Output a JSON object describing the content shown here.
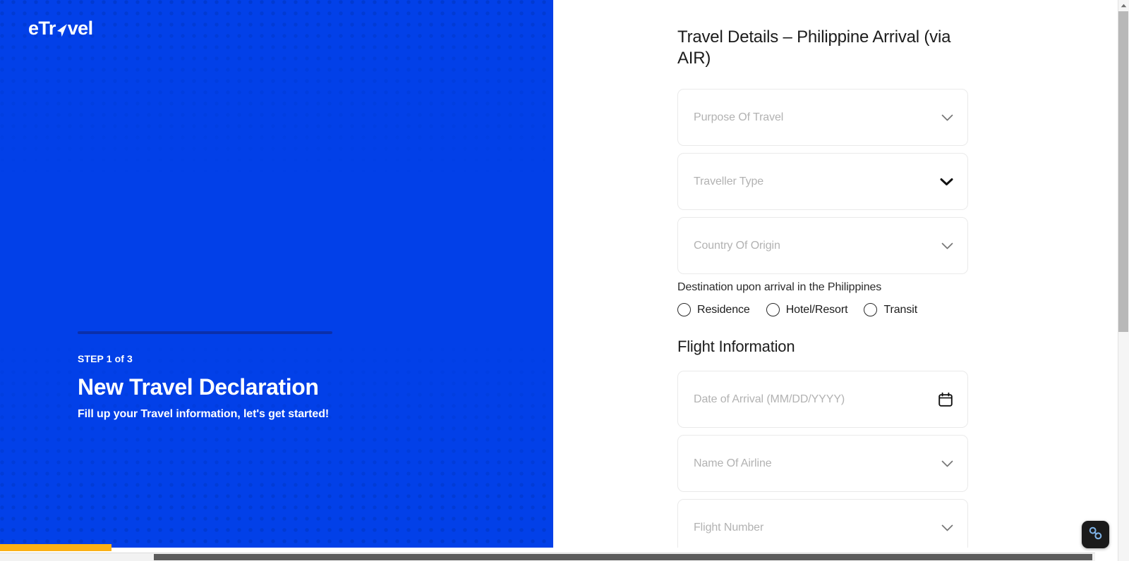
{
  "brand": {
    "logo_text_before": "eTr",
    "logo_text_after": "vel",
    "logo_icon": "paper-plane-icon",
    "panel_color": "#0240E8"
  },
  "left_panel": {
    "step_label": "STEP 1 of 3",
    "title": "New Travel Declaration",
    "subtitle": "Fill up your Travel information, let's get started!",
    "progress_rule_color": "#0B2FAB"
  },
  "form": {
    "title": "Travel Details – Philippine Arrival (via AIR)",
    "fields": [
      {
        "name": "purpose-of-travel",
        "placeholder": "Purpose Of Travel",
        "trailing_icon": "chevron-down-icon",
        "icon_state": "light"
      },
      {
        "name": "traveller-type",
        "placeholder": "Traveller Type",
        "trailing_icon": "chevron-down-icon",
        "icon_state": "dark"
      },
      {
        "name": "country-of-origin",
        "placeholder": "Country Of Origin",
        "trailing_icon": "chevron-down-icon",
        "icon_state": "light"
      }
    ],
    "destination": {
      "label": "Destination upon arrival in the Philippines",
      "options": [
        {
          "label": "Residence",
          "selected": false
        },
        {
          "label": "Hotel/Resort",
          "selected": false
        },
        {
          "label": "Transit",
          "selected": false
        }
      ]
    },
    "flight_section_title": "Flight Information",
    "flight_fields": [
      {
        "name": "date-of-arrival",
        "placeholder": "Date of Arrival (MM/DD/YYYY)",
        "trailing_icon": "calendar-icon",
        "icon_state": "dark"
      },
      {
        "name": "name-of-airline",
        "placeholder": "Name Of Airline",
        "trailing_icon": "chevron-down-icon",
        "icon_state": "light"
      },
      {
        "name": "flight-number",
        "placeholder": "Flight Number",
        "trailing_icon": "chevron-down-icon",
        "icon_state": "light"
      }
    ]
  },
  "chrome": {
    "page_progress_color": "#FBB015",
    "accessibility_icon": "link-chain-icon",
    "accessibility_icon_color": "#7FB3E8"
  }
}
